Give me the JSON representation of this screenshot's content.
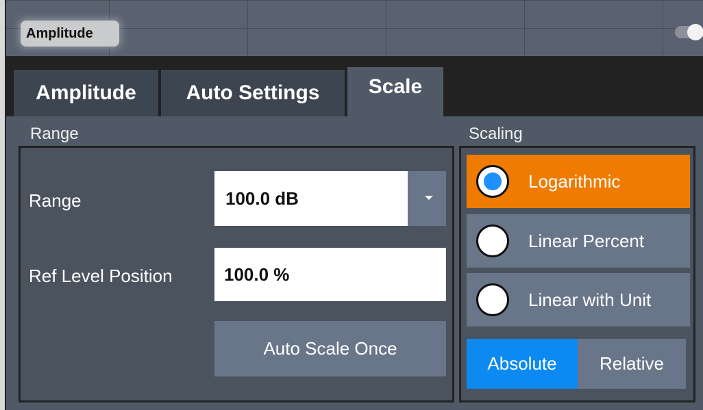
{
  "window": {
    "title": "Amplitude"
  },
  "tabs": [
    {
      "label": "Amplitude",
      "active": false
    },
    {
      "label": "Auto Settings",
      "active": false
    },
    {
      "label": "Scale",
      "active": true
    }
  ],
  "range_group": {
    "title": "Range",
    "range": {
      "label": "Range",
      "value": "100.0 dB"
    },
    "ref_level_position": {
      "label": "Ref Level Position",
      "value": "100.0 %"
    },
    "auto_scale_button": "Auto Scale Once"
  },
  "scaling_group": {
    "title": "Scaling",
    "options": [
      {
        "label": "Logarithmic",
        "selected": true
      },
      {
        "label": "Linear Percent",
        "selected": false
      },
      {
        "label": "Linear with Unit",
        "selected": false
      }
    ],
    "mode": {
      "absolute": "Absolute",
      "relative": "Relative",
      "selected": "Absolute"
    }
  },
  "colors": {
    "selected_option": "#ef7b00",
    "selected_segment": "#0d8af2",
    "radio_dot": "#1e90ff",
    "panel_bg": "#505a66"
  },
  "icons": {
    "dropdown": "caret-down-icon",
    "toggle": "toggle-switch-icon"
  }
}
